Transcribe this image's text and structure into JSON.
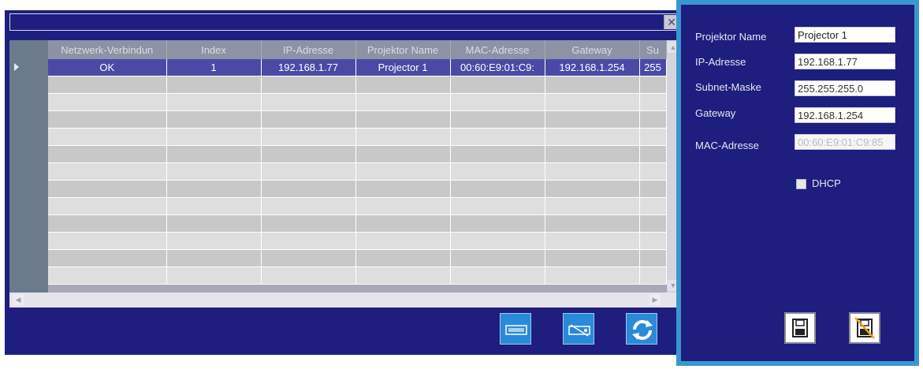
{
  "window": {
    "close_icon": "close-x-icon"
  },
  "table": {
    "columns": [
      "Netzwerk-Verbindun",
      "Index",
      "IP-Adresse",
      "Projektor Name",
      "MAC-Adresse",
      "Gateway",
      "Su"
    ],
    "selected_row": [
      "OK",
      "1",
      "192.168.1.77",
      "Projector 1",
      "00:60:E9:01:C9:",
      "192.168.1.254",
      "255"
    ],
    "empty_rows": 12
  },
  "toolbar": {
    "icons": [
      "projector-icon",
      "projector-connect-icon",
      "refresh-icon"
    ]
  },
  "panel": {
    "fields": [
      {
        "label": "Projektor Name",
        "value": "Projector 1"
      },
      {
        "label": "IP-Adresse",
        "value": "192.168.1.77"
      },
      {
        "label": "Subnet-Maske",
        "value": "255.255.255.0"
      },
      {
        "label": "Gateway",
        "value": "192.168.1.254"
      },
      {
        "label": "MAC-Adresse",
        "value": "00:60:E9:01:C9:85"
      }
    ],
    "dhcp_label": "DHCP",
    "save_icon": "save-disk-icon",
    "discard_icon": "discard-disk-icon"
  },
  "colors": {
    "window_bg": "#1e1e7e",
    "selected_row": "#4a4aa6",
    "accent": "#3b96cf",
    "tool_button": "#2a8ad8"
  }
}
